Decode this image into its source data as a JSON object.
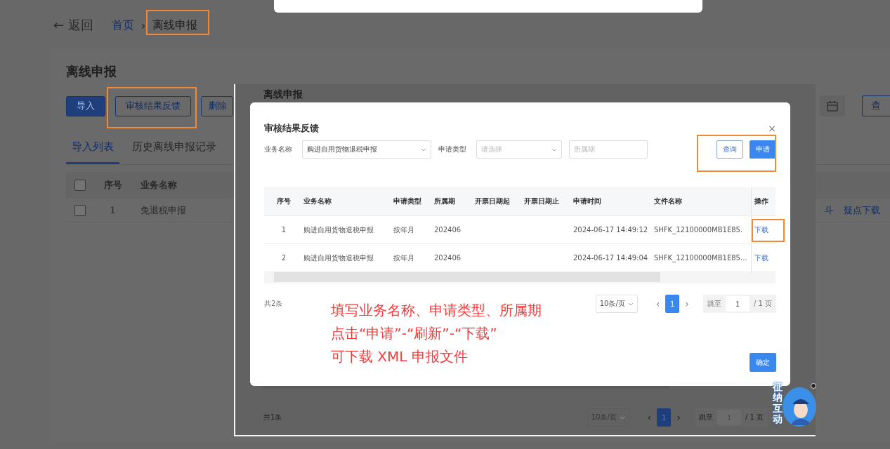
{
  "page": {
    "back": "← 返回",
    "breadcrumb_separator": "›",
    "breadcrumb": [
      {
        "label": "首页",
        "current": false
      },
      {
        "label": "离线申报",
        "current": true
      }
    ],
    "heading": "离线申报",
    "toolbar": [
      {
        "label": "导入",
        "kind": "primary"
      },
      {
        "label": "审核结果反馈",
        "kind": "outline"
      },
      {
        "label": "删除",
        "kind": "outline"
      }
    ],
    "search_button": "查",
    "tabs": [
      {
        "label": "导入列表",
        "selected": true
      },
      {
        "label": "历史离线申报记录",
        "selected": false
      }
    ],
    "table": {
      "all_checked": false,
      "columns": [
        "序号",
        "业务名称"
      ],
      "rows": [
        {
          "checked": false,
          "cells": [
            "1",
            "免退税申报"
          ]
        }
      ]
    },
    "row_links": [
      "斗",
      "疑点下载"
    ]
  },
  "back_panel": {
    "title": "离线申报",
    "pagination": {
      "total": "共1条",
      "page_size": "10条/页",
      "prev": "‹",
      "next": "›",
      "pages": [
        {
          "label": "1",
          "selected": true
        }
      ],
      "jump_label": "跳至",
      "jump_value": "1",
      "page_count": "/ 1 页"
    }
  },
  "dialog": {
    "title": "审核结果反馈",
    "close": "×",
    "filters": [
      {
        "kind": "select",
        "label": "业务名称",
        "value": "购进自用货物退税申报"
      },
      {
        "kind": "select",
        "label": "申请类型",
        "placeholder": "请选择"
      },
      {
        "kind": "input",
        "placeholder": "所属期"
      }
    ],
    "buttons": [
      {
        "label": "查询",
        "kind": "outline"
      },
      {
        "label": "申请",
        "kind": "primary"
      }
    ],
    "table": {
      "columns": [
        "序号",
        "业务名称",
        "申请类型",
        "所属期",
        "开票日期起",
        "开票日期止",
        "申请时间",
        "文件名称",
        "操作"
      ],
      "rows": [
        {
          "cells": [
            "1",
            "购进自用货物退税申报",
            "按年月",
            "202406",
            null,
            null,
            "2024-06-17 14:49:12",
            "SHFK_12100000MB1E85.",
            "下载"
          ]
        },
        {
          "cells": [
            "2",
            "购进自用货物退税申报",
            "按年月",
            "202406",
            null,
            null,
            "2024-06-17 14:49:04",
            "SHFK_12100000MB1E85...",
            "下载"
          ]
        }
      ]
    },
    "pagination": {
      "total": "共2条",
      "page_size": "10条/页",
      "prev": "‹",
      "next": "›",
      "pages": [
        {
          "label": "1",
          "selected": true
        }
      ],
      "jump_label": "跳至",
      "jump_value": "1",
      "page_count": "/ 1 页"
    },
    "confirm": "确定"
  },
  "annotation": {
    "lines": [
      "填写业务名称、申请类型、所属期",
      "点击“申请”-“刷新”-“下载”",
      "可下载 XML 申报文件"
    ]
  },
  "assistant": {
    "label": "征纳互动"
  }
}
